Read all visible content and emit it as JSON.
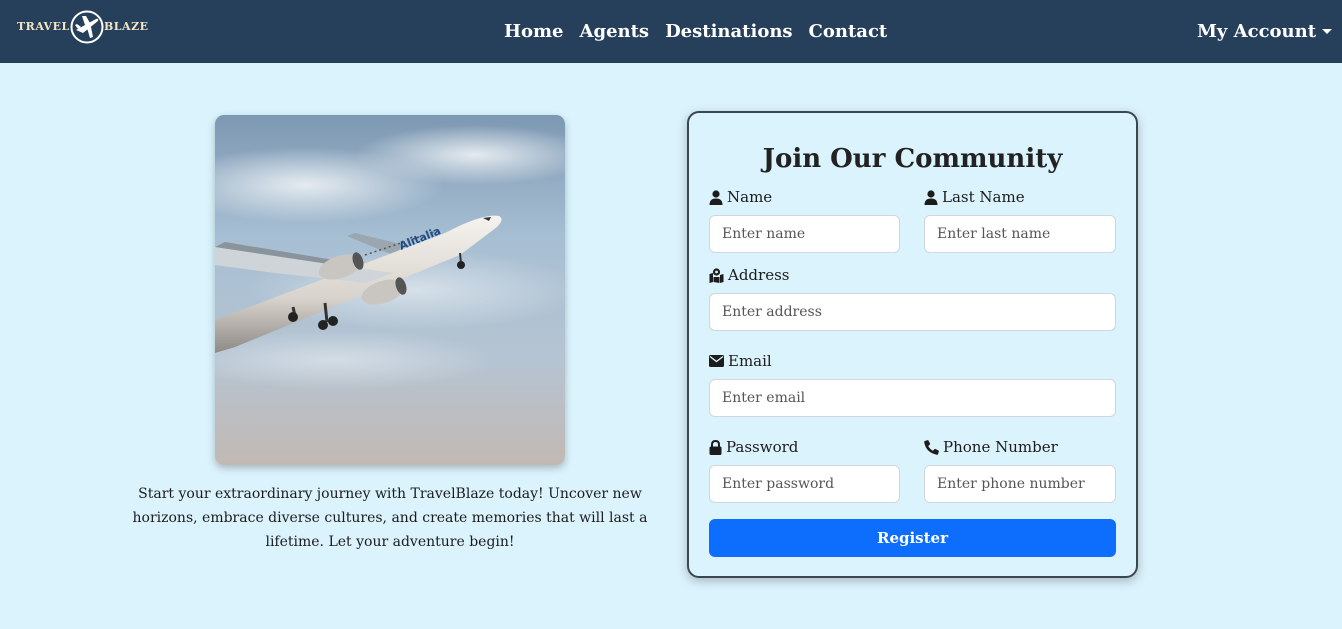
{
  "brand": {
    "left_text": "TRAVEL",
    "right_text": "BLAZE",
    "icon": "airplane-icon",
    "colors": {
      "navbar": "#263f5a",
      "logo_text": "#f3e6c6"
    }
  },
  "nav": {
    "links": [
      "Home",
      "Agents",
      "Destinations",
      "Contact"
    ],
    "account_label": "My Account"
  },
  "hero": {
    "image": "airplane-photo",
    "text": "Start your extraordinary journey with TravelBlaze today! Uncover new horizons, embrace diverse cultures, and create memories that will last a lifetime. Let your adventure begin!"
  },
  "form": {
    "title": "Join Our Community",
    "fields": {
      "name": {
        "label": "Name",
        "placeholder": "Enter name",
        "icon": "user-icon"
      },
      "last_name": {
        "label": "Last Name",
        "placeholder": "Enter last name",
        "icon": "user-icon"
      },
      "address": {
        "label": "Address",
        "placeholder": "Enter address",
        "icon": "map-location-icon"
      },
      "email": {
        "label": "Email",
        "placeholder": "Enter email",
        "icon": "envelope-icon"
      },
      "password": {
        "label": "Password",
        "placeholder": "Enter password",
        "icon": "lock-icon"
      },
      "phone": {
        "label": "Phone Number",
        "placeholder": "Enter phone number",
        "icon": "phone-icon"
      }
    },
    "submit_label": "Register",
    "colors": {
      "button": "#0d6efd",
      "page_background": "#dbf3fd"
    }
  }
}
